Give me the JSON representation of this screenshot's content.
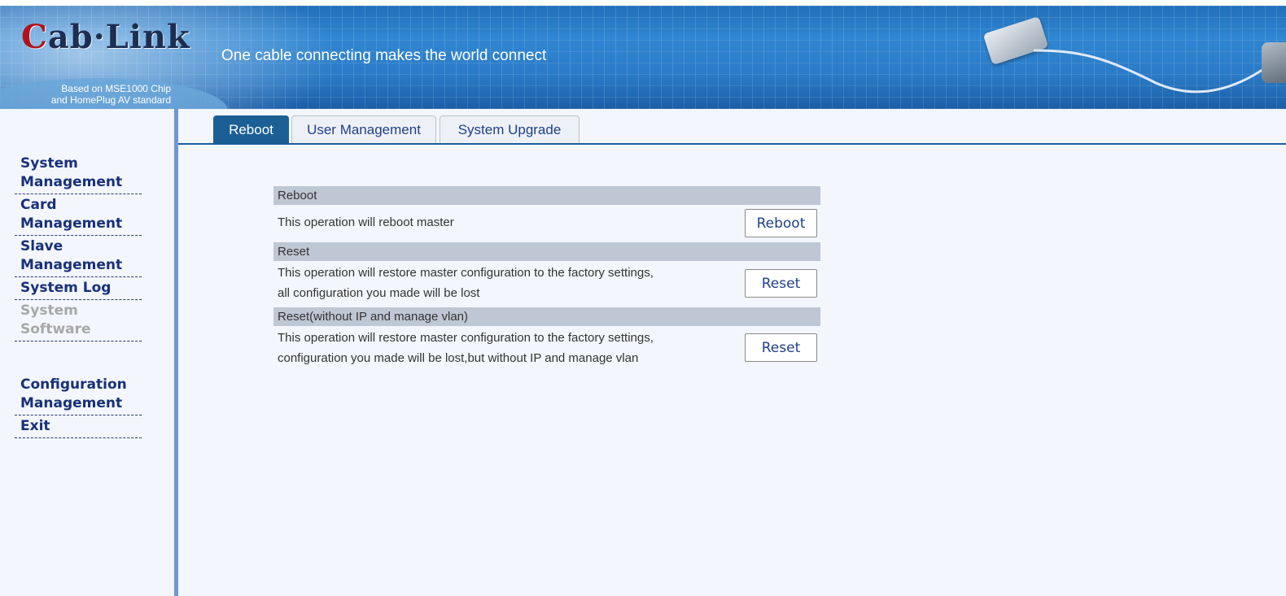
{
  "header": {
    "logo_text": "Cab·Link",
    "subtitle_line1": "Based on MSE1000 Chip",
    "subtitle_line2": "and HomePlug AV standard",
    "tagline": "One cable connecting makes the world connect"
  },
  "sidebar": {
    "items": [
      {
        "label_line1": "System",
        "label_line2": "Management",
        "enabled": true
      },
      {
        "label_line1": "Card",
        "label_line2": "Management",
        "enabled": true
      },
      {
        "label_line1": "Slave",
        "label_line2": "Management",
        "enabled": true
      },
      {
        "label_line1": "System Log",
        "label_line2": "",
        "enabled": true
      },
      {
        "label_line1": "System",
        "label_line2": "Software",
        "enabled": false
      },
      {
        "label_line1": "Configuration",
        "label_line2": "Management",
        "enabled": true
      },
      {
        "label_line1": "Exit",
        "label_line2": "",
        "enabled": true
      }
    ]
  },
  "tabs": [
    {
      "label": "Reboot",
      "active": true
    },
    {
      "label": "User Management",
      "active": false
    },
    {
      "label": "System Upgrade",
      "active": false
    }
  ],
  "sections": {
    "reboot": {
      "title": "Reboot",
      "desc_line1": "This operation will reboot master",
      "button": "Reboot"
    },
    "reset": {
      "title": "Reset",
      "desc_line1": "This operation will restore master configuration to the factory settings,",
      "desc_line2": "all configuration you made will be lost",
      "button": "Reset"
    },
    "reset_keep": {
      "title": "Reset(without IP and manage vlan)",
      "desc_line1": "This operation will restore master configuration to the factory settings,",
      "desc_line2": "configuration you made will be lost,but without IP and manage vlan",
      "button": "Reset"
    }
  },
  "colors": {
    "banner": "#2a7ac6",
    "menu_text": "#17307a",
    "menu_disabled": "#a8a8a8",
    "tab_active": "#1b5f95",
    "section_header": "#bfc6d4"
  }
}
